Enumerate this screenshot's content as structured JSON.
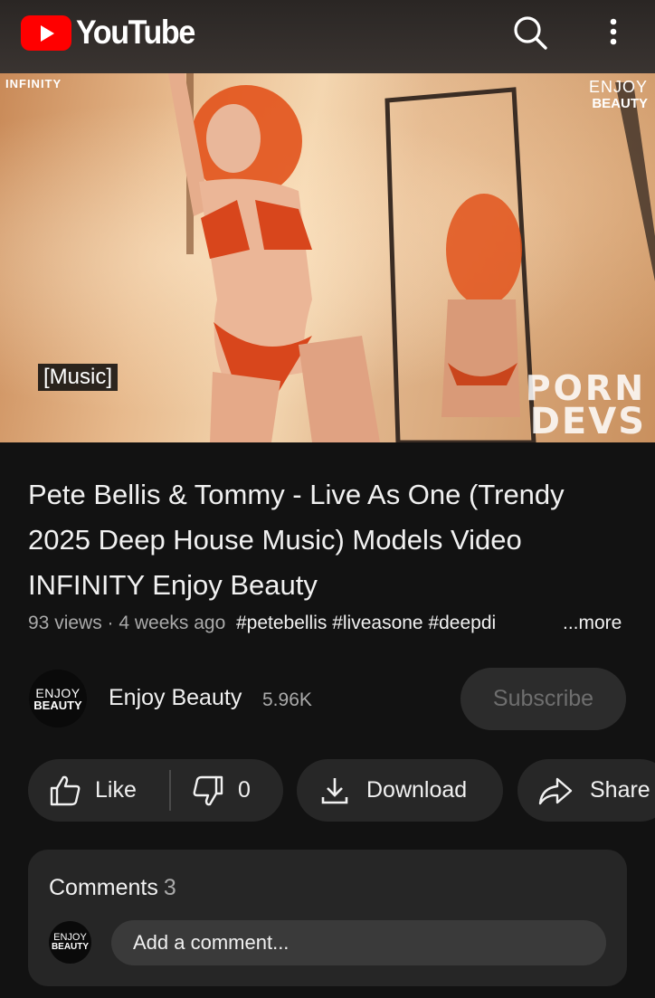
{
  "header": {
    "logo_text": "YouTube"
  },
  "video": {
    "watermark_left": "INFINITY",
    "watermark_right_line1": "ENJOY",
    "watermark_right_line2": "BEAUTY",
    "caption": "[Music]",
    "watermark_corner_line1": "PORN",
    "watermark_corner_line2": "DEVS"
  },
  "details": {
    "title": "Pete Bellis & Tommy - Live As One (Trendy 2025 Deep House Music) Models Video INFINITY Enjoy Beauty",
    "views": "93 views",
    "separator": " · ",
    "age": "4 weeks ago",
    "hashtags": "#petebellis #liveasone #deepdi",
    "more_label": "...more"
  },
  "channel": {
    "avatar_line1": "ENJOY",
    "avatar_line2": "BEAUTY",
    "name": "Enjoy Beauty",
    "subscribers": "5.96K",
    "subscribe_label": "Subscribe"
  },
  "actions": {
    "like_label": "Like",
    "dislike_count": "0",
    "download_label": "Download",
    "share_label": "Share"
  },
  "comments": {
    "title": "Comments",
    "count": "3",
    "avatar_line1": "ENJOY",
    "avatar_line2": "BEAUTY",
    "placeholder": "Add a comment..."
  },
  "colors": {
    "background": "#121212",
    "brand_red": "#ff0000",
    "pill_bg": "#272727",
    "muted_text": "#aaaaaa"
  },
  "icons": [
    "youtube-logo-icon",
    "search-icon",
    "more-vert-icon",
    "thumb-up-icon",
    "thumb-down-icon",
    "download-icon",
    "share-icon"
  ]
}
